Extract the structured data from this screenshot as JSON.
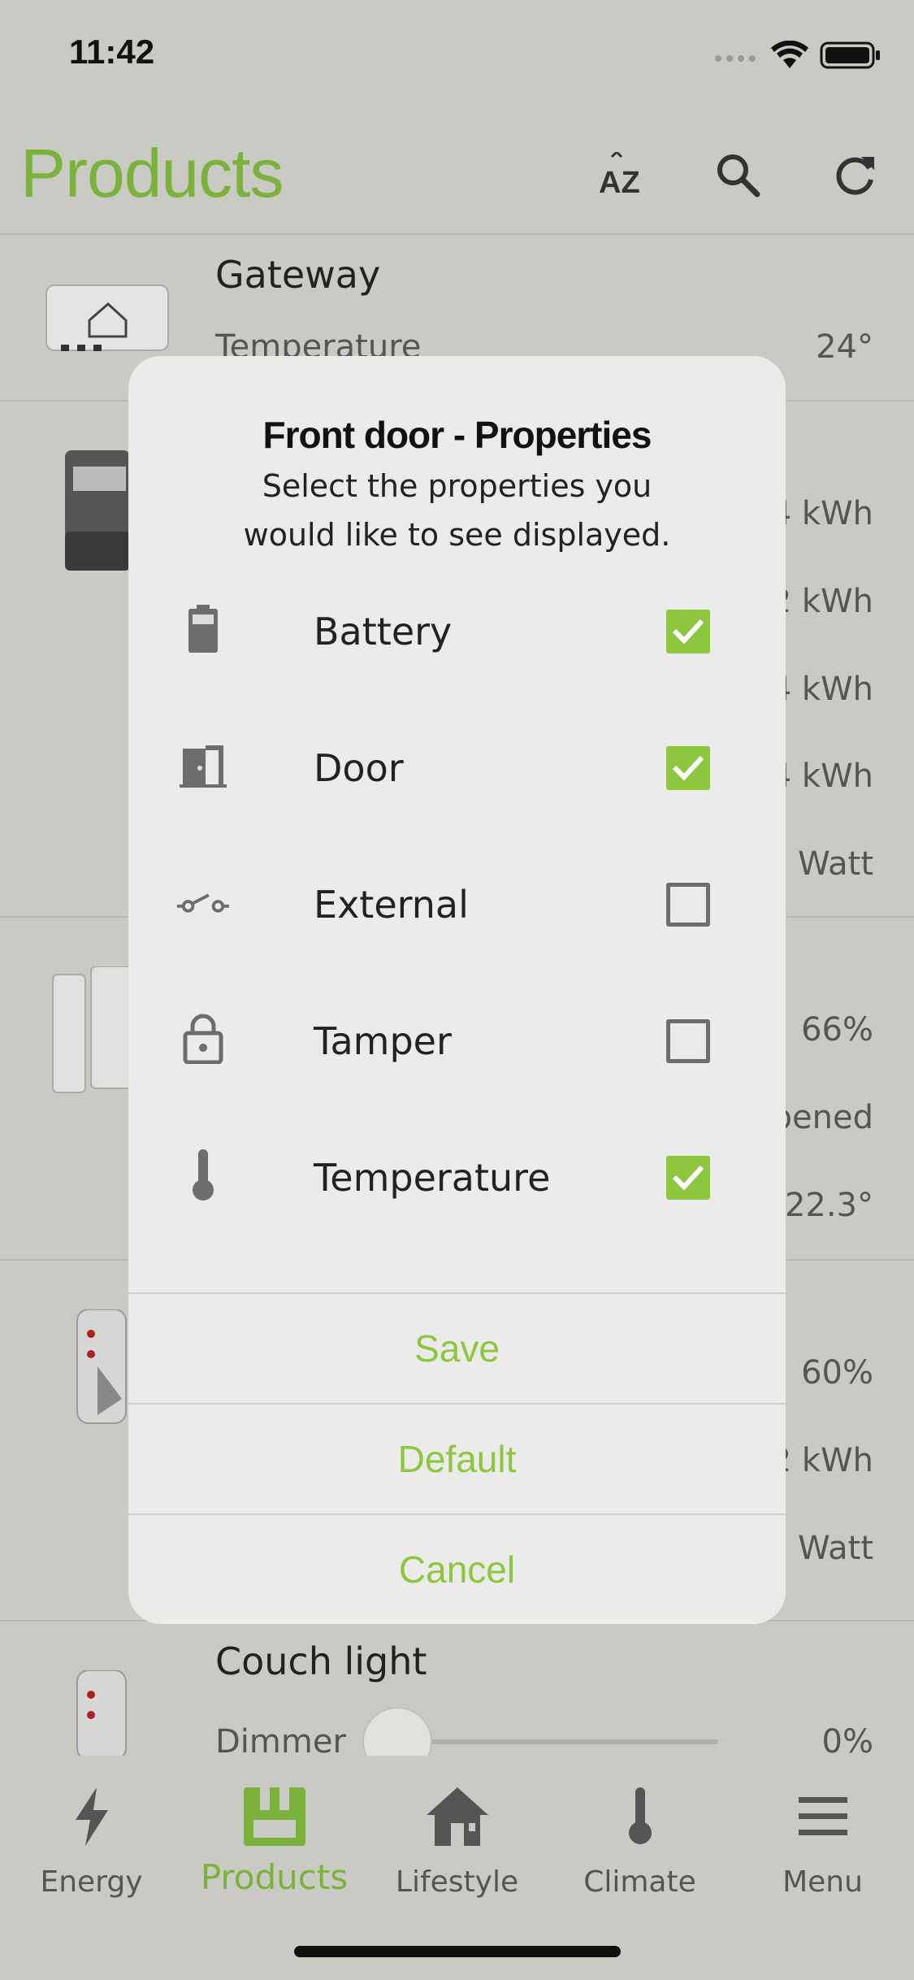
{
  "status": {
    "time": "11:42"
  },
  "header": {
    "title": "Products"
  },
  "list": {
    "gateway": {
      "name": "Gateway",
      "label": "Temperature",
      "value": "24°"
    },
    "meter": {
      "values": [
        "4 kWh",
        "2 kWh",
        "4 kWh",
        "4 kWh",
        "Watt"
      ]
    },
    "contact": {
      "values": [
        "66%",
        "pened",
        "22.3°"
      ]
    },
    "plug": {
      "values": [
        "60%",
        "2 kWh",
        "Watt"
      ]
    },
    "couch": {
      "name": "Couch light",
      "label": "Dimmer",
      "value": "0%"
    }
  },
  "dialog": {
    "title": "Front door - Properties",
    "subtitle_line1": "Select the properties you",
    "subtitle_line2": "would like to see displayed.",
    "properties": [
      {
        "label": "Battery",
        "icon": "battery-icon",
        "checked": true
      },
      {
        "label": "Door",
        "icon": "door-icon",
        "checked": true
      },
      {
        "label": "External",
        "icon": "switch-icon",
        "checked": false
      },
      {
        "label": "Tamper",
        "icon": "lock-icon",
        "checked": false
      },
      {
        "label": "Temperature",
        "icon": "thermometer-icon",
        "checked": true
      }
    ],
    "save": "Save",
    "default": "Default",
    "cancel": "Cancel"
  },
  "tabs": [
    {
      "label": "Energy",
      "icon": "lightning-icon",
      "active": false
    },
    {
      "label": "Products",
      "icon": "plug-icon",
      "active": true
    },
    {
      "label": "Lifestyle",
      "icon": "house-icon",
      "active": false
    },
    {
      "label": "Climate",
      "icon": "thermometer-icon",
      "active": false
    },
    {
      "label": "Menu",
      "icon": "hamburger-icon",
      "active": false
    }
  ],
  "colors": {
    "accent": "#7ab23b",
    "checkbox": "#8dc63f",
    "background": "#cacac5",
    "dialog": "#ebebe9"
  }
}
